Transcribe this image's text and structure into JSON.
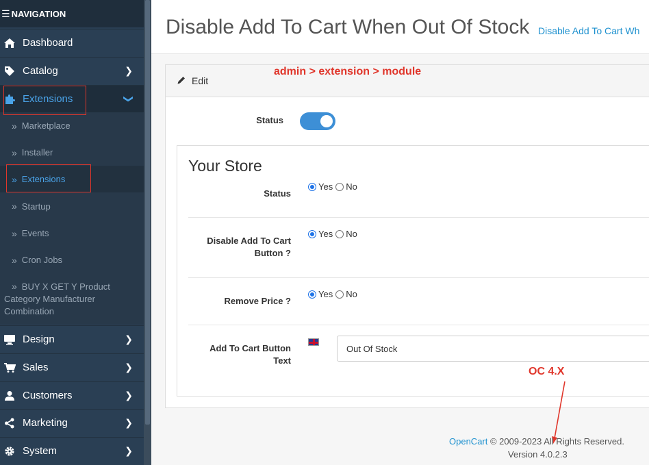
{
  "sidebar": {
    "header": "NAVIGATION",
    "items": [
      {
        "label": "Dashboard"
      },
      {
        "label": "Catalog"
      },
      {
        "label": "Extensions"
      },
      {
        "label": "Design"
      },
      {
        "label": "Sales"
      },
      {
        "label": "Customers"
      },
      {
        "label": "Marketing"
      },
      {
        "label": "System"
      }
    ],
    "subitems": [
      {
        "label": "Marketplace"
      },
      {
        "label": "Installer"
      },
      {
        "label": "Extensions"
      },
      {
        "label": "Startup"
      },
      {
        "label": "Events"
      },
      {
        "label": "Cron Jobs"
      }
    ],
    "multi_item": {
      "line1": "BUY X GET Y Product",
      "line2": "Category Manufacturer",
      "line3": "Combination"
    }
  },
  "header": {
    "title": "Disable Add To Cart When Out Of Stock",
    "breadcrumb": "Disable Add To Cart Wh"
  },
  "card": {
    "edit_label": "Edit",
    "annotation": "admin > extension > module",
    "status_label": "Status",
    "status_on": true
  },
  "store": {
    "title": "Your Store",
    "fields": [
      {
        "label": "Status",
        "selected": "Yes"
      },
      {
        "label_line1": "Disable Add To Cart",
        "label_line2": "Button ?",
        "selected": "Yes"
      },
      {
        "label": "Remove Price ?",
        "selected": "Yes"
      }
    ],
    "yes": "Yes",
    "no": "No",
    "text_field": {
      "label_line1": "Add To Cart Button",
      "label_line2": "Text",
      "value": "Out Of Stock"
    }
  },
  "annotation2": "OC 4.X",
  "footer": {
    "link": "OpenCart",
    "copyright": " © 2009-2023 All Rights Reserved.",
    "version": "Version 4.0.2.3"
  },
  "colors": {
    "sidebar_bg": "#2a3f54",
    "accent": "#1e91cf",
    "annotation_red": "#e0362b",
    "toggle_on": "#3d8fd6"
  }
}
